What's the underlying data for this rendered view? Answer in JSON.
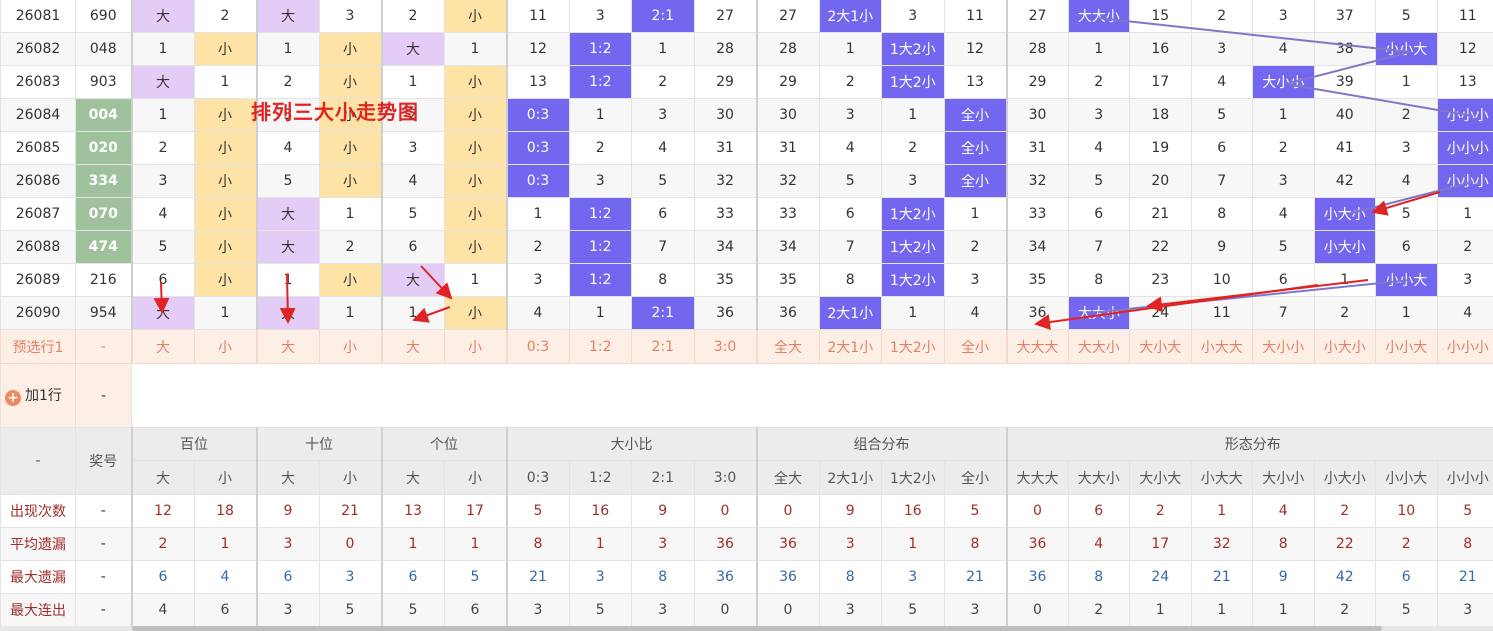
{
  "overlay_title": "排列三大小走势图",
  "main_rows": [
    {
      "issue": "26081",
      "num": "690",
      "cells": [
        "大",
        "2",
        "大",
        "3",
        "2",
        "小",
        "11",
        "3",
        "2:1",
        "27",
        "27",
        "2大1小",
        "3",
        "11",
        "27",
        "大大小",
        "15",
        "2",
        "3",
        "37",
        "5",
        "11"
      ]
    },
    {
      "issue": "26082",
      "num": "048",
      "cells": [
        "1",
        "小",
        "1",
        "小",
        "大",
        "1",
        "12",
        "1:2",
        "1",
        "28",
        "28",
        "1",
        "1大2小",
        "12",
        "28",
        "1",
        "16",
        "3",
        "4",
        "38",
        "小小大",
        "12"
      ]
    },
    {
      "issue": "26083",
      "num": "903",
      "cells": [
        "大",
        "1",
        "2",
        "小",
        "1",
        "小",
        "13",
        "1:2",
        "2",
        "29",
        "29",
        "2",
        "1大2小",
        "13",
        "29",
        "2",
        "17",
        "4",
        "大小小",
        "39",
        "1",
        "13"
      ]
    },
    {
      "issue": "26084",
      "num": "004",
      "cells": [
        "1",
        "小",
        "3",
        "小",
        "2",
        "小",
        "0:3",
        "1",
        "3",
        "30",
        "30",
        "3",
        "1",
        "全小",
        "30",
        "3",
        "18",
        "5",
        "1",
        "40",
        "2",
        "小小小"
      ]
    },
    {
      "issue": "26085",
      "num": "020",
      "cells": [
        "2",
        "小",
        "4",
        "小",
        "3",
        "小",
        "0:3",
        "2",
        "4",
        "31",
        "31",
        "4",
        "2",
        "全小",
        "31",
        "4",
        "19",
        "6",
        "2",
        "41",
        "3",
        "小小小"
      ]
    },
    {
      "issue": "26086",
      "num": "334",
      "cells": [
        "3",
        "小",
        "5",
        "小",
        "4",
        "小",
        "0:3",
        "3",
        "5",
        "32",
        "32",
        "5",
        "3",
        "全小",
        "32",
        "5",
        "20",
        "7",
        "3",
        "42",
        "4",
        "小小小"
      ]
    },
    {
      "issue": "26087",
      "num": "070",
      "cells": [
        "4",
        "小",
        "大",
        "1",
        "5",
        "小",
        "1",
        "1:2",
        "6",
        "33",
        "33",
        "6",
        "1大2小",
        "1",
        "33",
        "6",
        "21",
        "8",
        "4",
        "小大小",
        "5",
        "1"
      ]
    },
    {
      "issue": "26088",
      "num": "474",
      "cells": [
        "5",
        "小",
        "大",
        "2",
        "6",
        "小",
        "2",
        "1:2",
        "7",
        "34",
        "34",
        "7",
        "1大2小",
        "2",
        "34",
        "7",
        "22",
        "9",
        "5",
        "小大小",
        "6",
        "2"
      ]
    },
    {
      "issue": "26089",
      "num": "216",
      "cells": [
        "6",
        "小",
        "1",
        "小",
        "大",
        "1",
        "3",
        "1:2",
        "8",
        "35",
        "35",
        "8",
        "1大2小",
        "3",
        "35",
        "8",
        "23",
        "10",
        "6",
        "1",
        "小小大",
        "3"
      ]
    },
    {
      "issue": "26090",
      "num": "954",
      "cells": [
        "大",
        "1",
        "大",
        "1",
        "1",
        "小",
        "4",
        "1",
        "2:1",
        "36",
        "36",
        "2大1小",
        "1",
        "4",
        "36",
        "大大小",
        "24",
        "11",
        "7",
        "2",
        "1",
        "4"
      ]
    }
  ],
  "preselect": {
    "label": "预选行1",
    "dash": "-",
    "cells": [
      "大",
      "小",
      "大",
      "小",
      "大",
      "小",
      "0:3",
      "1:2",
      "2:1",
      "3:0",
      "全大",
      "2大1小",
      "1大2小",
      "全小",
      "大大大",
      "大大小",
      "大小大",
      "小大大",
      "大小小",
      "小大小",
      "小小大",
      "小小小"
    ]
  },
  "add_row": {
    "plus": "+",
    "label": "加1行",
    "dash": "-"
  },
  "stats": {
    "corner": "-",
    "award": "奖号",
    "groups": [
      "百位",
      "十位",
      "个位",
      "大小比",
      "组合分布",
      "形态分布"
    ],
    "subheads": [
      "大",
      "小",
      "大",
      "小",
      "大",
      "小",
      "0:3",
      "1:2",
      "2:1",
      "3:0",
      "全大",
      "2大1小",
      "1大2小",
      "全小",
      "大大大",
      "大大小",
      "大小大",
      "小大大",
      "大小小",
      "小大小",
      "小小大",
      "小小小"
    ],
    "rows": [
      {
        "label": "出现次数",
        "dash": "-",
        "values": [
          "12",
          "18",
          "9",
          "21",
          "13",
          "17",
          "5",
          "16",
          "9",
          "0",
          "0",
          "9",
          "16",
          "5",
          "0",
          "6",
          "2",
          "1",
          "4",
          "2",
          "10",
          "5"
        ]
      },
      {
        "label": "平均遗漏",
        "dash": "-",
        "values": [
          "2",
          "1",
          "3",
          "0",
          "1",
          "1",
          "8",
          "1",
          "3",
          "36",
          "36",
          "3",
          "1",
          "8",
          "36",
          "4",
          "17",
          "32",
          "8",
          "22",
          "2",
          "8"
        ]
      },
      {
        "label": "最大遗漏",
        "dash": "-",
        "values": [
          "6",
          "4",
          "6",
          "3",
          "6",
          "5",
          "21",
          "3",
          "8",
          "36",
          "36",
          "8",
          "3",
          "21",
          "36",
          "8",
          "24",
          "21",
          "9",
          "42",
          "6",
          "21"
        ]
      },
      {
        "label": "最大连出",
        "dash": "-",
        "values": [
          "4",
          "6",
          "3",
          "5",
          "5",
          "6",
          "3",
          "5",
          "3",
          "0",
          "0",
          "3",
          "5",
          "3",
          "0",
          "2",
          "1",
          "1",
          "1",
          "2",
          "5",
          "3"
        ]
      }
    ]
  },
  "colors": {
    "big": "#e3ccf6",
    "small": "#fde3a5",
    "hit": "#7367f0",
    "green": "#9fc29c",
    "arrow": "#e02424",
    "line": "#7f78c8"
  }
}
